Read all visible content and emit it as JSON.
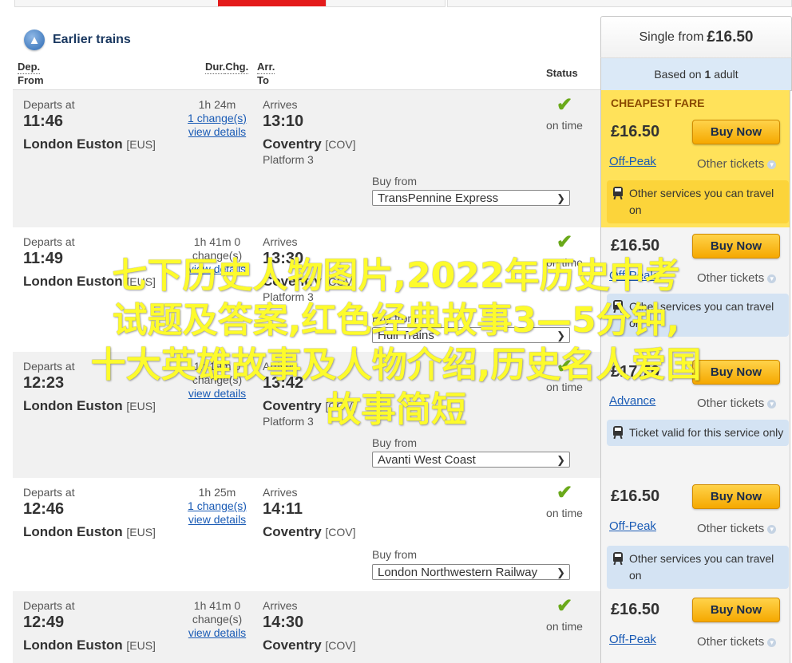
{
  "earlier": {
    "label": "Earlier trains"
  },
  "single": {
    "prefix": "Single from",
    "price": "£16.50"
  },
  "based": {
    "prefix": "Based on",
    "count": "1",
    "suffix": "adult"
  },
  "headers": {
    "dep": "Dep.",
    "from": "From",
    "dur": "Dur.",
    "chg": "Chg.",
    "arr": "Arr.",
    "to": "To",
    "status": "Status"
  },
  "labels": {
    "departs": "Departs at",
    "arrives": "Arrives",
    "buy_from": "Buy from",
    "view_details": "view details",
    "on_time": "on time",
    "buy_now": "Buy Now",
    "other_tickets": "Other tickets",
    "cheapest": "CHEAPEST FARE"
  },
  "journeys": [
    {
      "dep_time": "11:46",
      "dep_station": "London Euston",
      "dep_code": "[EUS]",
      "duration": "1h 24m",
      "changes": "1 change(s)",
      "arr_time": "13:10",
      "arr_station": "Coventry",
      "arr_code": "[COV]",
      "platform": "Platform 3",
      "operator": "TransPennine Express",
      "price": "£16.50",
      "fare_type": "Off-Peak",
      "note": "Other services you can travel on"
    },
    {
      "dep_time": "11:49",
      "dep_station": "London Euston",
      "dep_code": "[EUS]",
      "duration": "1h 41m",
      "changes": "0 change(s)",
      "arr_time": "13:30",
      "arr_station": "Coventry",
      "arr_code": "[COV]",
      "platform": "Platform 3",
      "operator": "Hull Trains",
      "price": "£16.50",
      "fare_type": "Off-Peak",
      "note": "Other services you can travel on"
    },
    {
      "dep_time": "12:23",
      "dep_station": "London Euston",
      "dep_code": "[EUS]",
      "duration": "1h 19m",
      "changes": "0 change(s)",
      "arr_time": "13:42",
      "arr_station": "Coventry",
      "arr_code": "[COV]",
      "platform": "Platform 3",
      "operator": "Avanti West Coast",
      "price": "£17.70",
      "fare_type": "Advance",
      "note": "Ticket valid for this service only"
    },
    {
      "dep_time": "12:46",
      "dep_station": "London Euston",
      "dep_code": "[EUS]",
      "duration": "1h 25m",
      "changes": "1 change(s)",
      "arr_time": "14:11",
      "arr_station": "Coventry",
      "arr_code": "[COV]",
      "platform": "",
      "operator": "London Northwestern Railway",
      "price": "£16.50",
      "fare_type": "Off-Peak",
      "note": "Other services you can travel on"
    },
    {
      "dep_time": "12:49",
      "dep_station": "London Euston",
      "dep_code": "[EUS]",
      "duration": "1h 41m",
      "changes": "0 change(s)",
      "arr_time": "14:30",
      "arr_station": "Coventry",
      "arr_code": "[COV]",
      "platform": "",
      "operator": "",
      "price": "£16.50",
      "fare_type": "Off-Peak",
      "note": ""
    }
  ],
  "overlay": {
    "line1": "七下历史人物图片,2022年历史中考",
    "line2": "试题及答案,红色经典故事3—5分钟,",
    "line3": "十大英雄故事及人物介绍,历史名人爱国",
    "line4": "故事简短"
  }
}
